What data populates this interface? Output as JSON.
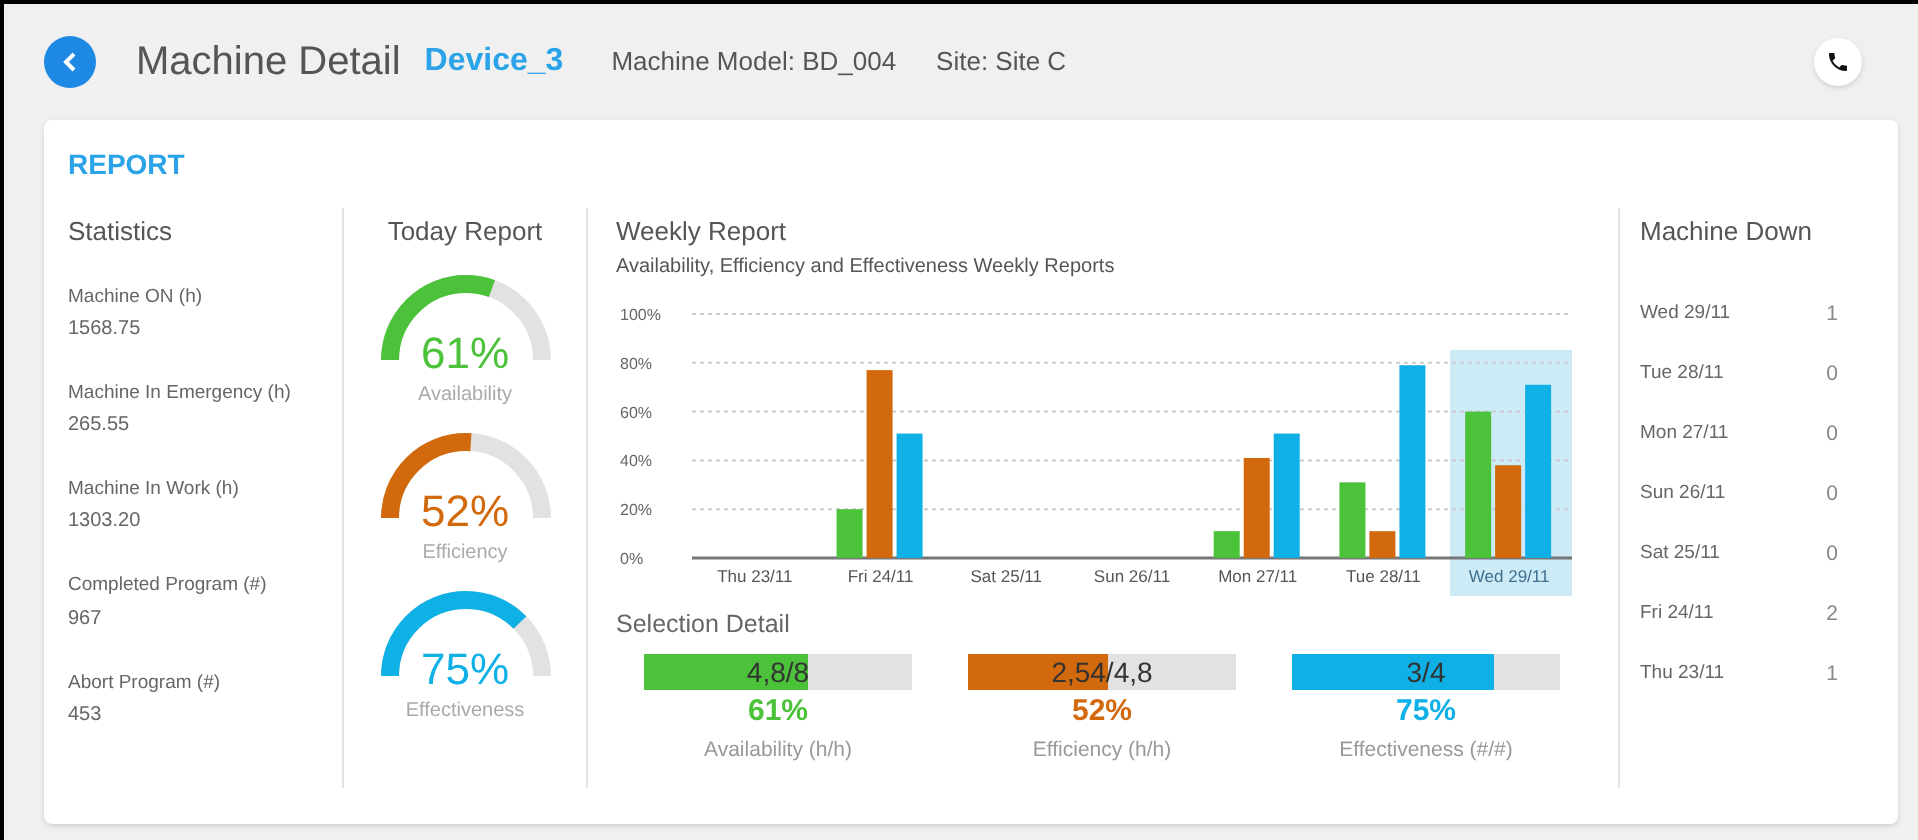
{
  "header": {
    "title": "Machine Detail",
    "device": "Device_3",
    "model": "Machine Model: BD_004",
    "site": "Site: Site C"
  },
  "section_title": "REPORT",
  "statistics": {
    "title": "Statistics",
    "items": [
      {
        "label": "Machine ON (h)",
        "value": "1568.75"
      },
      {
        "label": "Machine In Emergency (h)",
        "value": "265.55"
      },
      {
        "label": "Machine In Work (h)",
        "value": "1303.20"
      },
      {
        "label": "Completed Program (#)",
        "value": "967"
      },
      {
        "label": "Abort Program (#)",
        "value": "453"
      }
    ]
  },
  "today_report": {
    "title": "Today Report",
    "gauges": [
      {
        "value": "61%",
        "label": "Availability",
        "color": "#4cc13a"
      },
      {
        "value": "52%",
        "label": "Efficiency",
        "color": "#d2690c"
      },
      {
        "value": "75%",
        "label": "Effectiveness",
        "color": "#0fb0e6"
      }
    ]
  },
  "weekly_report": {
    "title": "Weekly Report",
    "subtitle": "Availability, Efficiency and Effectiveness Weekly Reports",
    "chart_data": {
      "type": "bar",
      "categories": [
        "Thu 23/11",
        "Fri 24/11",
        "Sat 25/11",
        "Sun 26/11",
        "Mon 27/11",
        "Tue 28/11",
        "Wed 29/11"
      ],
      "series": [
        {
          "color": "#4cc13a",
          "values": [
            0,
            20,
            0,
            0,
            11,
            31,
            60
          ]
        },
        {
          "color": "#d2690c",
          "values": [
            0,
            77,
            0,
            0,
            41,
            11,
            38
          ]
        },
        {
          "color": "#0fb0e6",
          "values": [
            0,
            51,
            0,
            0,
            51,
            79,
            71
          ]
        }
      ],
      "grid": true,
      "ylim": [
        0,
        100
      ],
      "yticks": [
        {
          "value": 0,
          "label": "0%"
        },
        {
          "value": 20,
          "label": "20%"
        },
        {
          "value": 40,
          "label": "40%"
        },
        {
          "value": 60,
          "label": "60%"
        },
        {
          "value": 80,
          "label": "80%"
        },
        {
          "value": 100,
          "label": "100%"
        }
      ]
    },
    "day_columns": [
      {
        "selected": false
      },
      {
        "selected": false
      },
      {
        "selected": false
      },
      {
        "selected": false
      },
      {
        "selected": false
      },
      {
        "selected": false
      },
      {
        "selected": true
      }
    ]
  },
  "selection_detail": {
    "title": "Selection Detail",
    "items": [
      {
        "ratio": "4,8/8",
        "value": "61%",
        "label": "Availability (h/h)",
        "level": 0.61,
        "color": "#4cc13a"
      },
      {
        "ratio": "2,54/4,8",
        "value": "52%",
        "label": "Efficiency (h/h)",
        "level": 0.52,
        "color": "#d2690c"
      },
      {
        "ratio": "3/4",
        "value": "75%",
        "label": "Effectiveness (#/#)",
        "level": 0.75,
        "color": "#0fb0e6"
      }
    ]
  },
  "machine_down": {
    "title": "Machine Down",
    "rows": [
      {
        "day": "Wed 29/11",
        "count": "1"
      },
      {
        "day": "Tue 28/11",
        "count": "0"
      },
      {
        "day": "Mon 27/11",
        "count": "0"
      },
      {
        "day": "Sun 26/11",
        "count": "0"
      },
      {
        "day": "Sat 25/11",
        "count": "0"
      },
      {
        "day": "Fri 24/11",
        "count": "2"
      },
      {
        "day": "Thu 23/11",
        "count": "1"
      }
    ]
  }
}
